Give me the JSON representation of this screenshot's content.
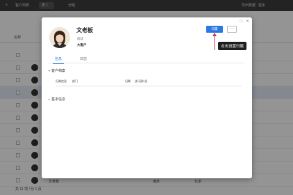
{
  "background": {
    "topbar": {
      "title": "客户列表",
      "tab1": "表 1",
      "tab2": "分组",
      "right1": "导出数据",
      "right2": "更多"
    },
    "toolbar": {
      "col1": "名称"
    },
    "rows_count": 11,
    "footer": "共 11 项 / 分 1 页",
    "cols": {
      "c1": "文老板",
      "c2": "海外",
      "c3": "北京"
    }
  },
  "modal": {
    "name": "文老板",
    "subtitle": "阅读",
    "tag": "大客户",
    "primary_button": "归属",
    "more_button": "···",
    "tabs": [
      {
        "label": "信息",
        "active": true
      },
      {
        "label": "日志",
        "active": false
      }
    ],
    "sections": {
      "customer_profile": "客户档案",
      "basic_info": "基本信息"
    },
    "fields": {
      "label1": "归属信息",
      "value1": "部门",
      "label2": "归属",
      "value2": "该马建3设"
    },
    "close_icon": "close-icon",
    "maximize_icon": "maximize-icon"
  },
  "annotation": {
    "tooltip": "点击设置归属",
    "arrow_color": "#c0306a"
  },
  "colors": {
    "accent": "#2b78e4",
    "overlay": "rgba(0,0,0,0.42)",
    "tooltip_bg": "#1e1e1e"
  }
}
